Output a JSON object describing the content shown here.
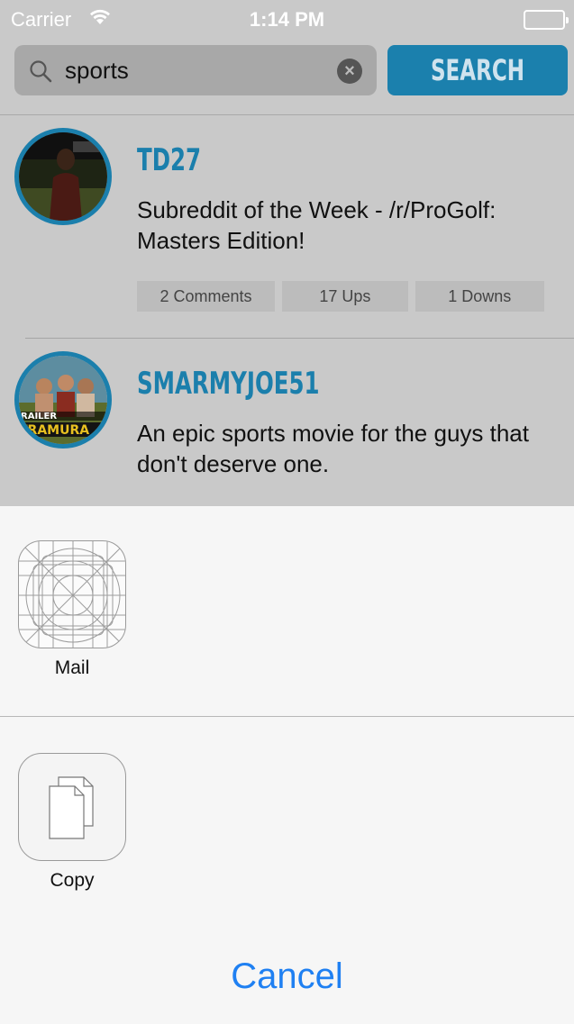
{
  "status_bar": {
    "carrier": "Carrier",
    "time": "1:14 PM"
  },
  "search": {
    "value": "sports",
    "button_label": "SEARCH"
  },
  "posts": [
    {
      "username": "TD27",
      "title": "Subreddit of the Week - /r/ProGolf: Masters Edition!",
      "comments": "2 Comments",
      "ups": "17 Ups",
      "downs": "1 Downs"
    },
    {
      "username": "SMARMYJOE51",
      "title": "An epic sports movie for the guys that don't deserve one.",
      "avatar_text_1": "RAILER",
      "avatar_text_2": "TRAMURA"
    }
  ],
  "share_sheet": {
    "mail_label": "Mail",
    "copy_label": "Copy",
    "cancel_label": "Cancel"
  },
  "colors": {
    "accent_blue": "#1b7fac",
    "cancel_blue": "#1f80f2"
  }
}
